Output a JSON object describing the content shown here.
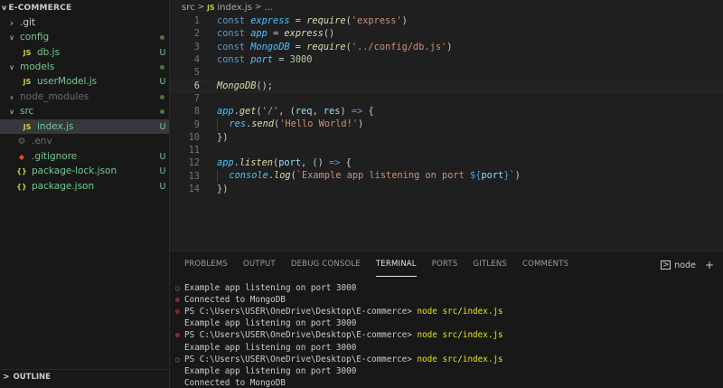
{
  "explorer": {
    "title": "E-COMMERCE",
    "items": [
      {
        "label": ".git",
        "chevron": ">",
        "icon": "",
        "status": "",
        "dot": false,
        "color": "#cccccc",
        "indent": 8
      },
      {
        "label": "config",
        "chevron": "v",
        "icon": "",
        "status": "",
        "dot": true,
        "color": "#73c991",
        "indent": 8
      },
      {
        "label": "db.js",
        "chevron": "",
        "icon": "JS",
        "status": "U",
        "dot": false,
        "color": "#73c991",
        "indent": 14
      },
      {
        "label": "models",
        "chevron": "v",
        "icon": "",
        "status": "",
        "dot": true,
        "color": "#73c991",
        "indent": 8
      },
      {
        "label": "userModel.js",
        "chevron": "",
        "icon": "JS",
        "status": "U",
        "dot": false,
        "color": "#73c991",
        "indent": 14
      },
      {
        "label": "node_modules",
        "chevron": ">",
        "icon": "",
        "status": "",
        "dot": true,
        "color": "#6c6c6c",
        "indent": 8
      },
      {
        "label": "src",
        "chevron": "v",
        "icon": "",
        "status": "",
        "dot": true,
        "color": "#73c991",
        "indent": 8
      },
      {
        "label": "index.js",
        "chevron": "",
        "icon": "JS",
        "status": "U",
        "dot": false,
        "color": "#73c991",
        "indent": 14
      },
      {
        "label": ".env",
        "chevron": "",
        "icon": "⚙",
        "status": "",
        "dot": false,
        "color": "#6c6c6c",
        "indent": 8
      },
      {
        "label": ".gitignore",
        "chevron": "",
        "icon": "◆",
        "status": "U",
        "dot": false,
        "color": "#73c991",
        "indent": 8
      },
      {
        "label": "package-lock.json",
        "chevron": "",
        "icon": "{}",
        "status": "U",
        "dot": false,
        "color": "#73c991",
        "indent": 8
      },
      {
        "label": "package.json",
        "chevron": "",
        "icon": "{}",
        "status": "U",
        "dot": false,
        "color": "#73c991",
        "indent": 8
      }
    ],
    "outline_label": "OUTLINE"
  },
  "breadcrumb": {
    "folder": "src",
    "file": "index.js",
    "symbol": "..."
  },
  "editor": {
    "lines": [
      {
        "n": "1",
        "tokens": [
          [
            "kw",
            "const "
          ],
          [
            "var",
            "express"
          ],
          [
            "op",
            " = "
          ],
          [
            "fn",
            "require"
          ],
          [
            "pun",
            "("
          ],
          [
            "str",
            "'express'"
          ],
          [
            "pun",
            ")"
          ]
        ]
      },
      {
        "n": "2",
        "tokens": [
          [
            "kw",
            "const "
          ],
          [
            "var",
            "app"
          ],
          [
            "op",
            " = "
          ],
          [
            "fn",
            "express"
          ],
          [
            "pun",
            "()"
          ]
        ]
      },
      {
        "n": "3",
        "tokens": [
          [
            "kw",
            "const "
          ],
          [
            "var",
            "MongoDB"
          ],
          [
            "op",
            " = "
          ],
          [
            "fn",
            "require"
          ],
          [
            "pun",
            "("
          ],
          [
            "str",
            "'../config/db.js'"
          ],
          [
            "pun",
            ")"
          ]
        ]
      },
      {
        "n": "4",
        "tokens": [
          [
            "kw",
            "const "
          ],
          [
            "var",
            "port"
          ],
          [
            "op",
            " = "
          ],
          [
            "num",
            "3000"
          ]
        ]
      },
      {
        "n": "5",
        "tokens": []
      },
      {
        "n": "6",
        "tokens": [
          [
            "fn",
            "MongoDB"
          ],
          [
            "pun",
            "();"
          ]
        ]
      },
      {
        "n": "7",
        "tokens": []
      },
      {
        "n": "8",
        "tokens": [
          [
            "var",
            "app"
          ],
          [
            "pun",
            "."
          ],
          [
            "fn",
            "get"
          ],
          [
            "pun",
            "("
          ],
          [
            "str",
            "'/'"
          ],
          [
            "pun",
            ", ("
          ],
          [
            "param",
            "req"
          ],
          [
            "pun",
            ", "
          ],
          [
            "param",
            "res"
          ],
          [
            "pun",
            ") "
          ],
          [
            "kw",
            "=>"
          ],
          [
            "pun",
            " {"
          ]
        ]
      },
      {
        "n": "9",
        "tokens": [
          [
            "ind",
            "  "
          ],
          [
            "var",
            "res"
          ],
          [
            "pun",
            "."
          ],
          [
            "fn",
            "send"
          ],
          [
            "pun",
            "("
          ],
          [
            "str",
            "'Hello World!'"
          ],
          [
            "pun",
            ")"
          ]
        ]
      },
      {
        "n": "10",
        "tokens": [
          [
            "pun",
            "})"
          ]
        ]
      },
      {
        "n": "11",
        "tokens": []
      },
      {
        "n": "12",
        "tokens": [
          [
            "var",
            "app"
          ],
          [
            "pun",
            "."
          ],
          [
            "fn",
            "listen"
          ],
          [
            "pun",
            "("
          ],
          [
            "param",
            "port"
          ],
          [
            "pun",
            ", () "
          ],
          [
            "kw",
            "=>"
          ],
          [
            "pun",
            " {"
          ]
        ]
      },
      {
        "n": "13",
        "tokens": [
          [
            "ind",
            "  "
          ],
          [
            "var",
            "console"
          ],
          [
            "pun",
            "."
          ],
          [
            "fn",
            "log"
          ],
          [
            "pun",
            "("
          ],
          [
            "str",
            "`Example app listening on port "
          ],
          [
            "tpl",
            "${"
          ],
          [
            "param",
            "port"
          ],
          [
            "tpl",
            "}"
          ],
          [
            "str",
            "`"
          ],
          [
            "pun",
            ")"
          ]
        ]
      },
      {
        "n": "14",
        "tokens": [
          [
            "pun",
            "})"
          ]
        ]
      }
    ],
    "current_line": "6"
  },
  "panel": {
    "tabs": [
      "PROBLEMS",
      "OUTPUT",
      "DEBUG CONSOLE",
      "TERMINAL",
      "PORTS",
      "GITLENS",
      "COMMENTS"
    ],
    "active_tab": "TERMINAL",
    "terminal_name": "node",
    "terminal_lines": [
      {
        "mark": "○",
        "kind": "ok",
        "text": "Example app listening on port 3000",
        "cmd": ""
      },
      {
        "mark": "⊗",
        "kind": "err",
        "text": "Connected to MongoDB",
        "cmd": ""
      },
      {
        "mark": "⊗",
        "kind": "err",
        "text": "PS C:\\Users\\USER\\OneDrive\\Desktop\\E-commerce> ",
        "cmd": "node src/index.js"
      },
      {
        "mark": "",
        "kind": "",
        "text": "Example app listening on port 3000",
        "cmd": ""
      },
      {
        "mark": "⊗",
        "kind": "err",
        "text": "PS C:\\Users\\USER\\OneDrive\\Desktop\\E-commerce> ",
        "cmd": "node src/index.js"
      },
      {
        "mark": "",
        "kind": "",
        "text": "Example app listening on port 3000",
        "cmd": ""
      },
      {
        "mark": "○",
        "kind": "ok",
        "text": "PS C:\\Users\\USER\\OneDrive\\Desktop\\E-commerce> ",
        "cmd": "node src/index.js"
      },
      {
        "mark": "",
        "kind": "",
        "text": "Example app listening on port 3000",
        "cmd": ""
      },
      {
        "mark": "",
        "kind": "",
        "text": "Connected to MongoDB",
        "cmd": ""
      }
    ]
  },
  "colors": {
    "keyword": "#569cd6",
    "variable": "#4fc1ff",
    "function": "#dcdcaa",
    "string": "#ce9178",
    "number": "#b5cea8",
    "param": "#9cdcfe",
    "punct": "#cccccc",
    "js_icon": "#cbcb41",
    "json_icon": "#cbcb41",
    "git_added": "#73c991"
  }
}
